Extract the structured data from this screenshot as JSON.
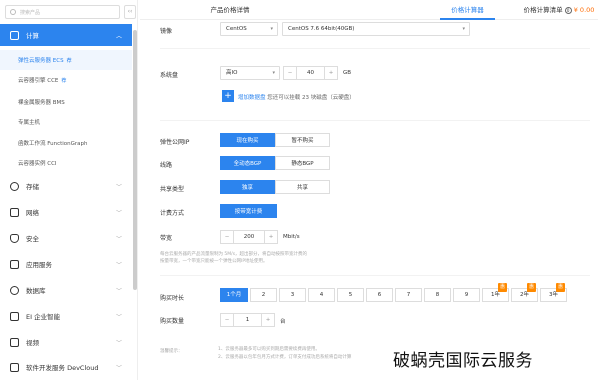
{
  "sidebar": {
    "search_placeholder": "搜索产品",
    "collapse": "‹‹",
    "compute": {
      "label": "计算"
    },
    "compute_items": [
      {
        "label": "弹性云服务器 ECS",
        "badge": "荐",
        "active": true
      },
      {
        "label": "云容器引擎 CCE",
        "badge": "荐",
        "active": false
      },
      {
        "label": "裸金属服务器 BMS",
        "badge": "",
        "active": false
      },
      {
        "label": "专属主机",
        "badge": "",
        "active": false
      },
      {
        "label": "函数工作流 FunctionGraph",
        "badge": "",
        "active": false
      },
      {
        "label": "云容器实例 CCI",
        "badge": "",
        "active": false
      }
    ],
    "groups": [
      {
        "label": "存储"
      },
      {
        "label": "网络"
      },
      {
        "label": "安全"
      },
      {
        "label": "应用服务"
      },
      {
        "label": "数据库"
      },
      {
        "label": "EI 企业智能"
      },
      {
        "label": "视频"
      },
      {
        "label": "软件开发服务 DevCloud"
      }
    ]
  },
  "tabs": {
    "detail": "产品价格详情",
    "calc": "价格计算器",
    "list": "价格计算清单",
    "list_count": "0",
    "price": "¥ 0.00"
  },
  "form": {
    "image": {
      "label": "镜像",
      "os": "CentOS",
      "version": "CentOS 7.6 64bit(40GB)"
    },
    "system_disk": {
      "label": "系统盘",
      "type": "高IO",
      "size": "40",
      "unit": "GB"
    },
    "add_disk": {
      "icon": "+",
      "text": "增加数据盘",
      "hint": "您还可以挂载 23 块磁盘（云硬盘）"
    },
    "eip": {
      "label": "弹性公网IP",
      "options": [
        "现在购买",
        "暂不购买"
      ]
    },
    "line": {
      "label": "线路",
      "options": [
        "全动态BGP",
        "静态BGP"
      ]
    },
    "share": {
      "label": "共享类型",
      "options": [
        "独享",
        "共享"
      ]
    },
    "billing": {
      "label": "计费方式",
      "option": "按带宽计费"
    },
    "bandwidth": {
      "label": "带宽",
      "value": "200",
      "unit": "Mbit/s"
    },
    "bw_note_1": "每台云服务器的产品流量限制为 5M/s，超出部分，将自动按照带宽计费的",
    "bw_note_2": "按量带宽，一个带宽只能被一个弹性公网IP地址使用。",
    "duration": {
      "label": "购买时长",
      "options": [
        "1个月",
        "2",
        "3",
        "4",
        "5",
        "6",
        "7",
        "8",
        "9",
        "1年",
        "2年",
        "3年"
      ],
      "badges": [
        "惠",
        "惠",
        "惠"
      ]
    },
    "quantity": {
      "label": "购买数量",
      "value": "1",
      "unit": "台"
    },
    "tips": {
      "label": "温馨提示：",
      "lines": [
        "1、云服务器最多可以购买到期后需要续费再使用。",
        "2、云服务器以包年包月方式计费，订单支付成功后系统将自动计算"
      ]
    }
  },
  "watermark": "破蜗壳国际云服务"
}
